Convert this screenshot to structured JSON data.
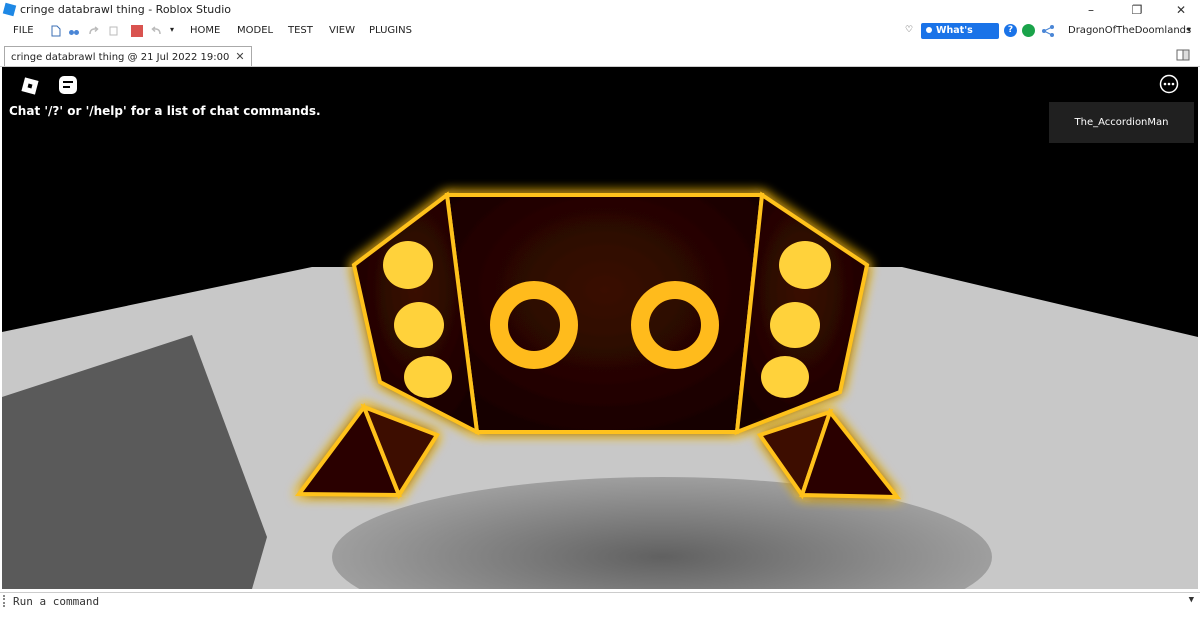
{
  "window": {
    "title": "cringe databrawl thing - Roblox Studio"
  },
  "menu": {
    "file": "FILE",
    "home": "HOME",
    "model": "MODEL",
    "test": "TEST",
    "view": "VIEW",
    "plugins": "PLUGINS"
  },
  "header": {
    "whats_new": "What's New",
    "username": "DragonOfTheDoomlands"
  },
  "tab": {
    "label": "cringe databrawl thing @ 21 Jul 2022 19:00"
  },
  "viewport": {
    "chat_hint": "Chat '/?' or '/help' for a list of chat commands.",
    "player": "The_AccordionMan"
  },
  "command_bar": {
    "placeholder": "Run a command"
  },
  "colors": {
    "neon": "#ffcc22",
    "glow": "#ff8c00",
    "accent": "#1a73e8"
  }
}
